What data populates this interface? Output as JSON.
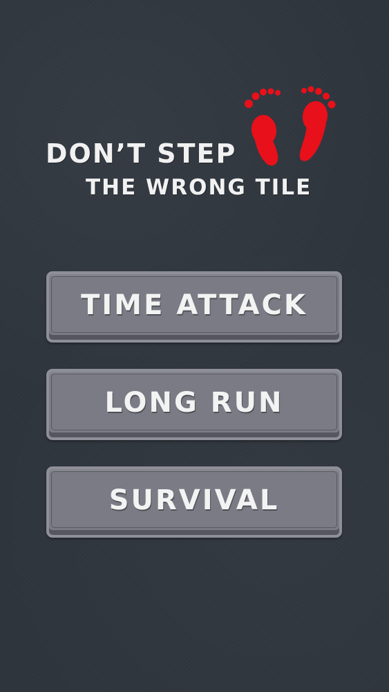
{
  "title": {
    "line1": "DON’T STEP",
    "line2": "THE WRONG TILE",
    "logo_icon": "red-footprints-icon",
    "logo_color": "#e8101a"
  },
  "menu": {
    "items": [
      {
        "label": "TIME ATTACK"
      },
      {
        "label": "LONG RUN"
      },
      {
        "label": "SURVIVAL"
      }
    ]
  },
  "colors": {
    "background": "#2f353d",
    "button_face": "#7a7b84",
    "button_border": "#8e8f98",
    "text": "#f1f1f1"
  }
}
